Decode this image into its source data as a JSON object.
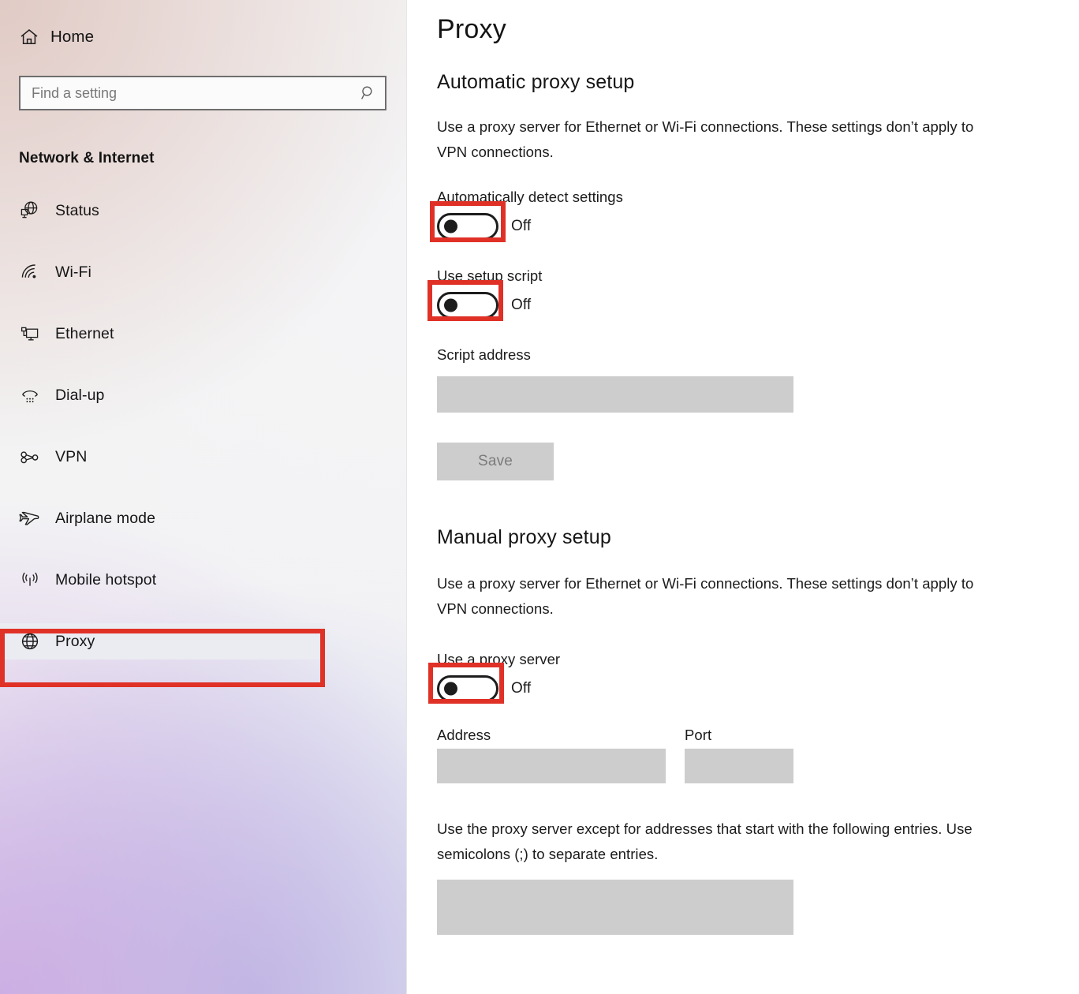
{
  "sidebar": {
    "home": {
      "label": "Home",
      "icon": "home-icon"
    },
    "search": {
      "value": "",
      "placeholder": "Find a setting",
      "icon": "search-icon"
    },
    "category_title": "Network & Internet",
    "accent_color": "#2463c8",
    "items": [
      {
        "label": "Status",
        "icon": "globe-monitor-icon",
        "selected": false
      },
      {
        "label": "Wi-Fi",
        "icon": "wifi-icon",
        "selected": false
      },
      {
        "label": "Ethernet",
        "icon": "ethernet-monitor-icon",
        "selected": false
      },
      {
        "label": "Dial-up",
        "icon": "dialup-phone-icon",
        "selected": false
      },
      {
        "label": "VPN",
        "icon": "vpn-key-icon",
        "selected": false
      },
      {
        "label": "Airplane mode",
        "icon": "airplane-icon",
        "selected": false
      },
      {
        "label": "Mobile hotspot",
        "icon": "hotspot-icon",
        "selected": false
      },
      {
        "label": "Proxy",
        "icon": "globe-icon",
        "selected": true
      }
    ]
  },
  "main": {
    "page_title": "Proxy",
    "automatic": {
      "heading": "Automatic proxy setup",
      "description": "Use a proxy server for Ethernet or Wi-Fi connections. These settings don’t apply to VPN connections.",
      "auto_detect": {
        "label": "Automatically detect settings",
        "state": "Off"
      },
      "setup_script": {
        "label": "Use setup script",
        "state": "Off"
      },
      "script_address": {
        "label": "Script address",
        "value": ""
      },
      "save_label": "Save"
    },
    "manual": {
      "heading": "Manual proxy setup",
      "description": "Use a proxy server for Ethernet or Wi-Fi connections. These settings don’t apply to VPN connections.",
      "use_proxy": {
        "label": "Use a proxy server",
        "state": "Off"
      },
      "address": {
        "label": "Address",
        "value": ""
      },
      "port": {
        "label": "Port",
        "value": ""
      },
      "exceptions_description": "Use the proxy server except for addresses that start with the following entries. Use semicolons (;) to separate entries.",
      "exceptions": {
        "value": ""
      }
    }
  },
  "annotations": {
    "highlight_color": "#e03127",
    "highlighted": [
      "sidebar-item-proxy",
      "automatically-detect-settings-toggle",
      "use-setup-script-toggle",
      "use-a-proxy-server-toggle"
    ]
  }
}
